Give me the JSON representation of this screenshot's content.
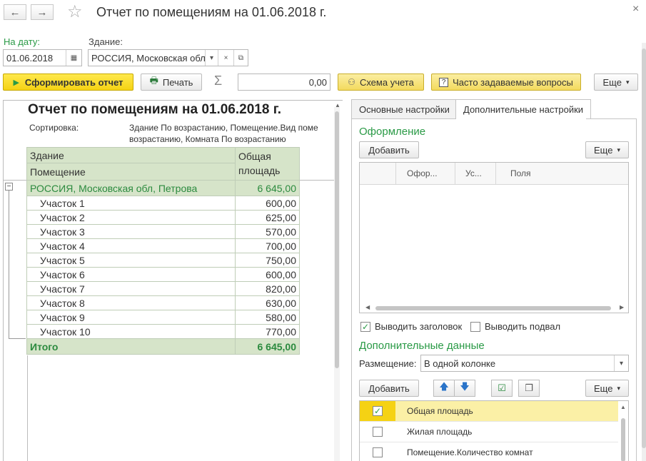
{
  "window": {
    "title": "Отчет по помещениям на 01.06.2018 г.",
    "back": "←",
    "forward": "→",
    "star": "☆",
    "close": "×"
  },
  "filters": {
    "date_label": "На дату:",
    "date_value": "01.06.2018",
    "building_label": "Здание:",
    "building_value": "РОССИЯ, Московская обл"
  },
  "toolbar": {
    "generate": "Сформировать отчет",
    "print": "Печать",
    "sigma": "Σ",
    "sum_value": "0,00",
    "scheme": "Схема учета",
    "faq": "Часто задаваемые вопросы",
    "more": "Еще"
  },
  "report": {
    "title": "Отчет по помещениям на 01.06.2018 г.",
    "sort_label": "Сортировка:",
    "sort_value": "Здание По возрастанию, Помещение.Вид поме",
    "sort_value2": "возрастанию, Комната По возрастанию",
    "col1_top": "Здание",
    "col1_bottom": "Помещение",
    "col2_top": "Общая",
    "col2_bottom": "площадь",
    "group_name": "РОССИЯ, Московская обл, Петрова",
    "group_total": "6 645,00",
    "rows": [
      {
        "name": "Участок 1",
        "value": "600,00"
      },
      {
        "name": "Участок 2",
        "value": "625,00"
      },
      {
        "name": "Участок 3",
        "value": "570,00"
      },
      {
        "name": "Участок 4",
        "value": "700,00"
      },
      {
        "name": "Участок 5",
        "value": "750,00"
      },
      {
        "name": "Участок 6",
        "value": "600,00"
      },
      {
        "name": "Участок 7",
        "value": "820,00"
      },
      {
        "name": "Участок 8",
        "value": "630,00"
      },
      {
        "name": "Участок 9",
        "value": "580,00"
      },
      {
        "name": "Участок 10",
        "value": "770,00"
      }
    ],
    "total_label": "Итого",
    "total_value": "6 645,00",
    "collapse_glyph": "−"
  },
  "settings": {
    "tab_main": "Основные настройки",
    "tab_extra": "Дополнительные настройки",
    "design_header": "Оформление",
    "add": "Добавить",
    "more": "Еще",
    "grid_cols": [
      "Офор...",
      "Ус...",
      "Поля"
    ],
    "show_header": "Выводить заголовок",
    "show_footer": "Выводить подвал",
    "extra_header": "Дополнительные данные",
    "placement_label": "Размещение:",
    "placement_value": "В одной колонке",
    "add2": "Добавить",
    "more2": "Еще",
    "fields": [
      {
        "label": "Общая площадь",
        "checked": true
      },
      {
        "label": "Жилая площадь",
        "checked": false
      },
      {
        "label": "Помещение.Количество комнат",
        "checked": false
      }
    ]
  },
  "colors": {
    "accent_green": "#2a9a46",
    "report_header_bg": "#d6e4c9",
    "yellow_button": "#f5d214",
    "selected_row": "#fbf0a6"
  }
}
